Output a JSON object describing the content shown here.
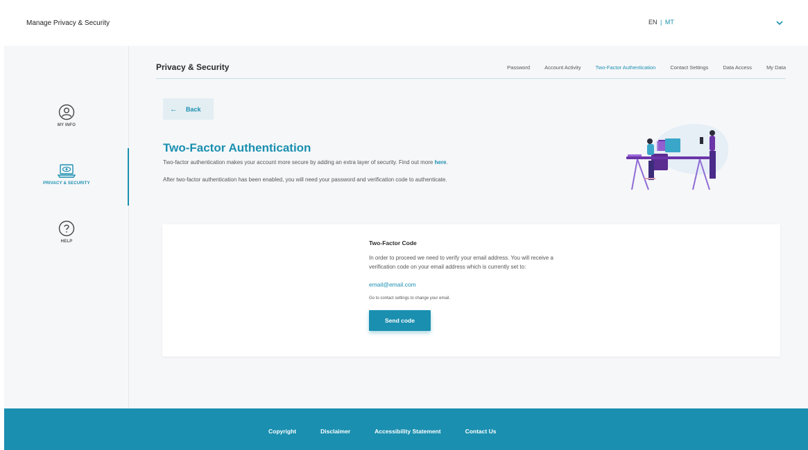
{
  "app": {
    "title": "Manage Privacy & Security"
  },
  "lang": {
    "en": "EN",
    "separator": "|",
    "mt": "MT"
  },
  "sidebar": {
    "items": [
      {
        "label": "MY INFO",
        "icon": "user-circle-icon"
      },
      {
        "label": "PRIVACY & SECURITY",
        "icon": "laptop-eye-icon"
      },
      {
        "label": "HELP",
        "icon": "question-circle-icon"
      }
    ]
  },
  "header": {
    "title": "Privacy & Security",
    "tabs": [
      {
        "label": "Password"
      },
      {
        "label": "Account Activity"
      },
      {
        "label": "Two-Factor Authentication",
        "active": true
      },
      {
        "label": "Contact Settings"
      },
      {
        "label": "Data Access"
      },
      {
        "label": "My Data"
      }
    ]
  },
  "main": {
    "back_label": "Back",
    "heading": "Two-Factor Authentication",
    "desc1_prefix": "Two-factor authentication makes your account more secure by adding an extra layer of security. Find out more ",
    "desc1_link": "here",
    "desc1_suffix": ".",
    "desc2": "After two-factor authentication has been enabled, you will need your password and verification code to authenticate."
  },
  "card": {
    "title": "Two-Factor Code",
    "text": "In order to proceed we need to verify your email address. You will receive a verification code on your email address which is currently set to:",
    "email": "email@email.com",
    "note": "Go to contact settings to change your email.",
    "button": "Send code"
  },
  "footer": {
    "links": [
      "Copyright",
      "Disclaimer",
      "Accessibility Statement",
      "Contact Us"
    ]
  },
  "colors": {
    "accent": "#1a8fb0",
    "background": "#f6f7f9"
  }
}
